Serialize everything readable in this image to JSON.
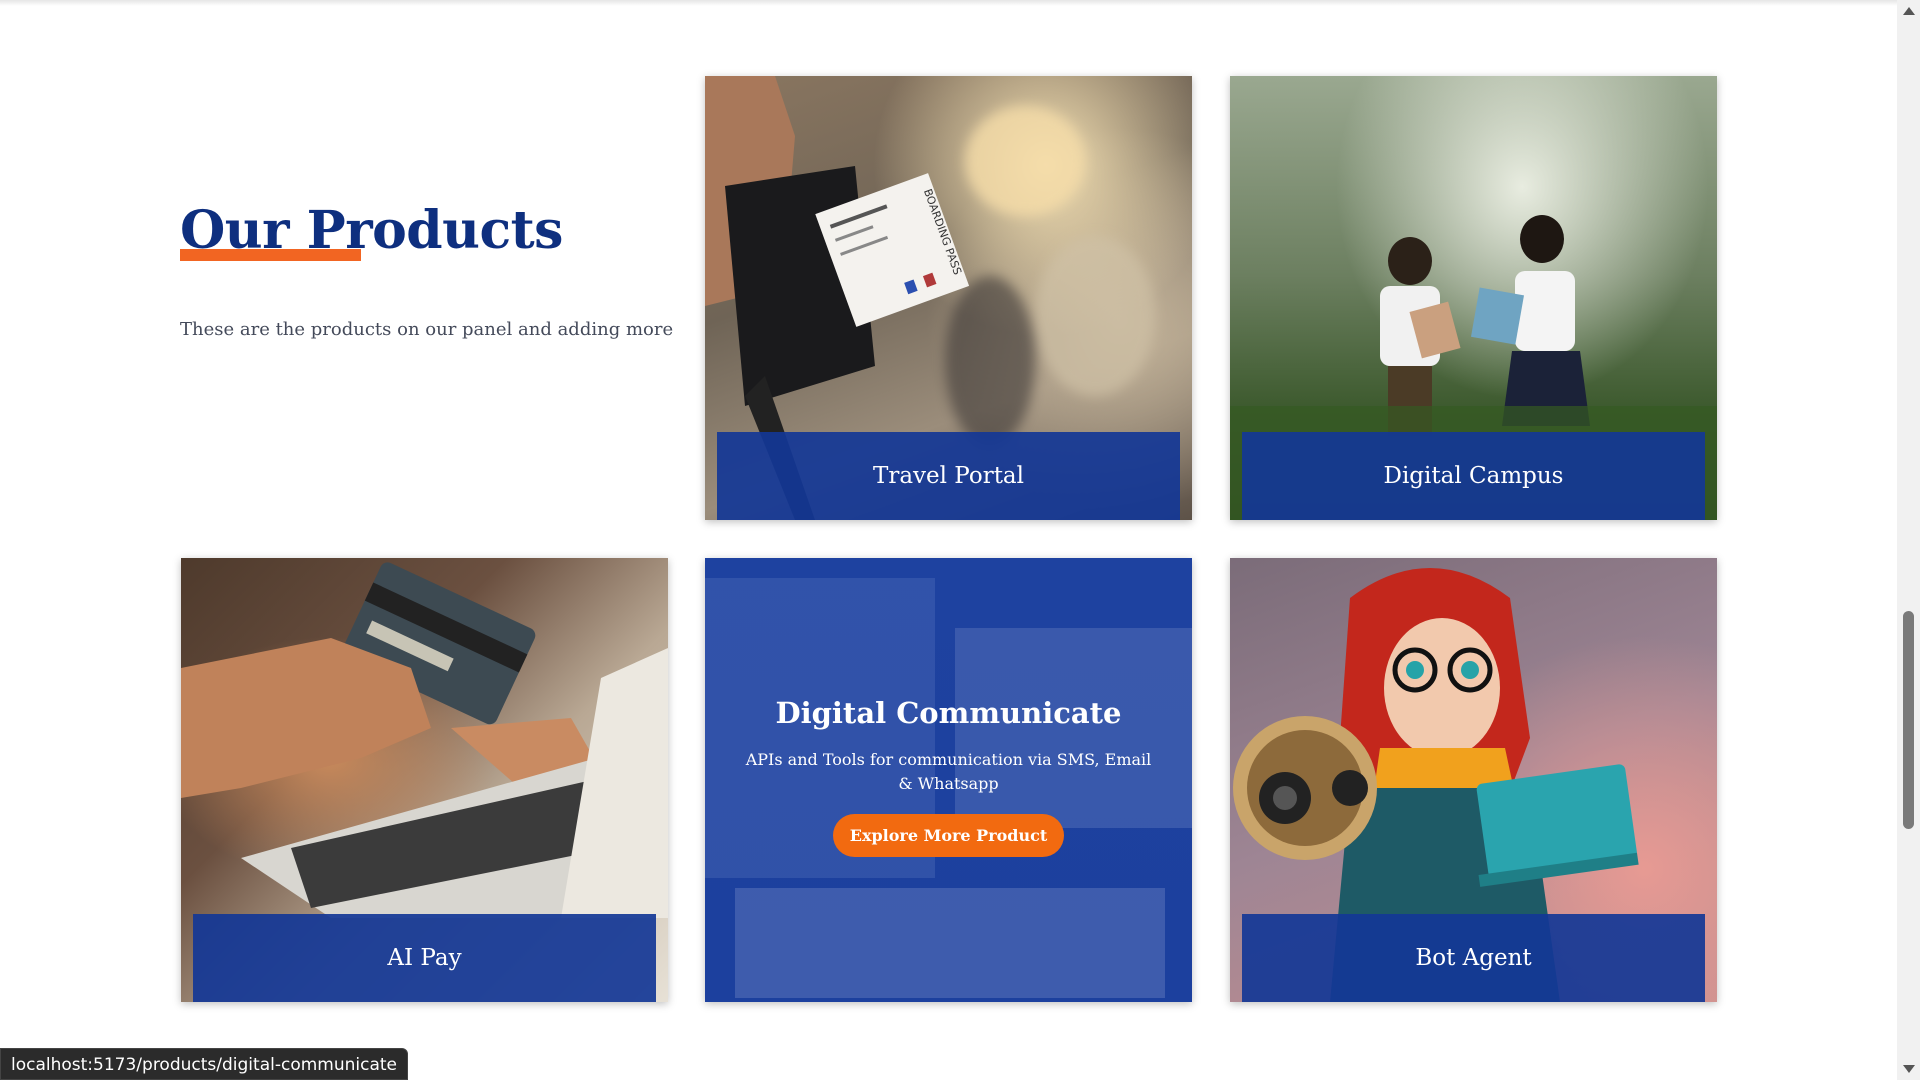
{
  "section": {
    "title": "Our Products",
    "subtitle": "These are the products on our panel and adding more"
  },
  "products": [
    {
      "label": "Travel Portal"
    },
    {
      "label": "Digital Campus"
    },
    {
      "label": "AI Pay"
    },
    {
      "label": "Digital Communicate",
      "description": "APIs and Tools for communication via SMS, Email & Whatsapp",
      "button": "Explore More Product"
    },
    {
      "label": "Bot Agent"
    }
  ],
  "photo_text": {
    "travel_ticket": "BOARDING PASS"
  },
  "status_bar": {
    "url": "localhost:5173/products/digital-communicate"
  },
  "colors": {
    "brand_blue": "#0e2f7f",
    "label_blue": "#1437a0",
    "accent_orange": "#f26522"
  }
}
